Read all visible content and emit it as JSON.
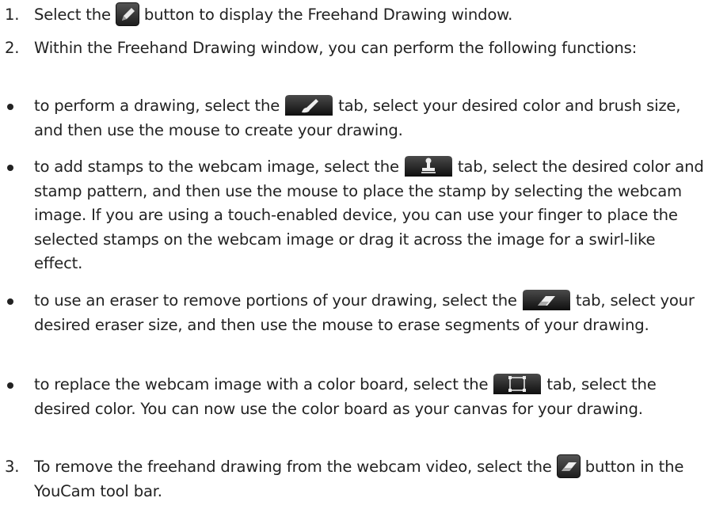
{
  "steps": [
    {
      "number": "1.",
      "before": "Select the",
      "icon": "pencil-button-icon",
      "after": "button to display the Freehand Drawing window."
    },
    {
      "number": "2.",
      "text": "Within the Freehand Drawing window, you can perform the following functions:"
    },
    {
      "number": "3.",
      "before": "To remove the freehand drawing from the webcam video, select the",
      "icon": "eraser-button-icon",
      "after": "button in the YouCam tool bar."
    }
  ],
  "bullets": [
    {
      "before": "to perform a drawing, select the",
      "icon": "brush-tab-icon",
      "after": "tab, select your desired color and brush size, and then use the mouse to create your drawing."
    },
    {
      "before": "to add stamps to the webcam image, select the",
      "icon": "stamp-tab-icon",
      "after": "tab, select the desired color and stamp pattern, and then use the mouse to place the stamp by selecting the webcam image. If you are using a touch-enabled device, you can use your finger to place the selected stamps on the webcam image or drag it across the image for a swirl-like effect."
    },
    {
      "before": "to use an eraser to remove portions of your drawing, select the",
      "icon": "eraser-tab-icon",
      "after": "tab, select your desired eraser size, and then use the mouse to erase segments of your drawing."
    },
    {
      "before": "to replace the webcam image with a color board, select the",
      "icon": "color-board-tab-icon",
      "after": "tab, select the desired color. You can now use the color board as your canvas for your drawing."
    }
  ],
  "colors": {
    "text": "#222222",
    "button_dark": "#2b2b2b",
    "tab_dark": "#1a1a1a",
    "icon_light": "#eeeeee"
  }
}
